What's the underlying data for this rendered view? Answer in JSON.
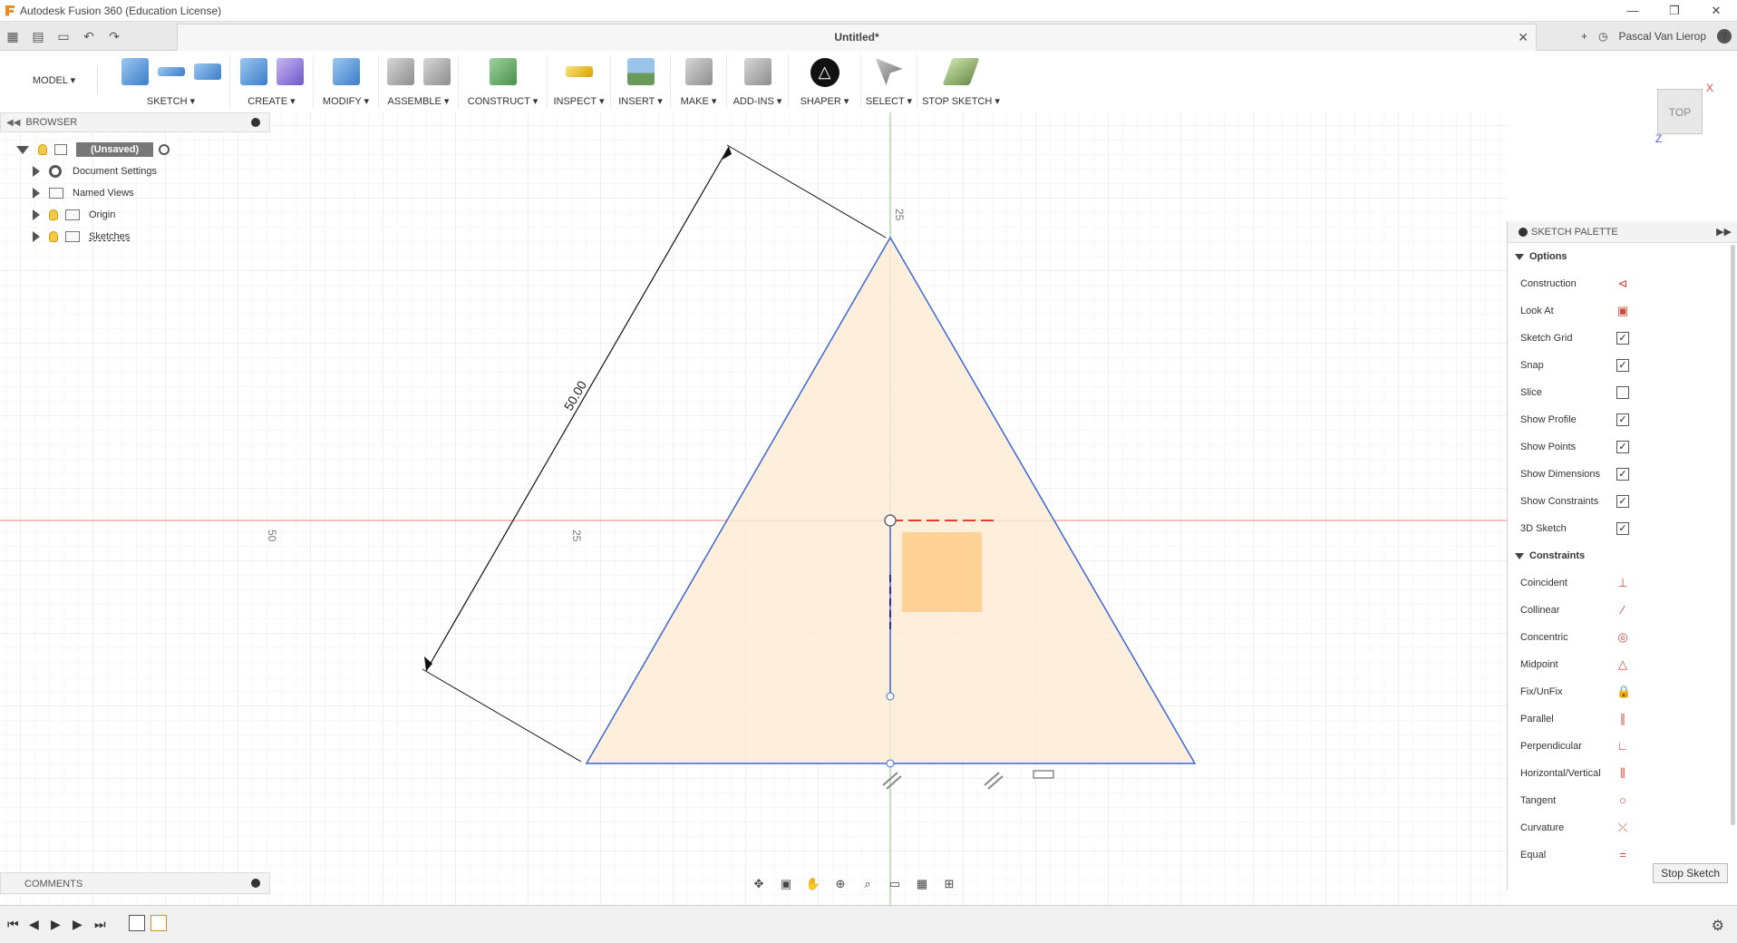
{
  "window": {
    "title": "Autodesk Fusion 360 (Education License)",
    "min": "—",
    "max": "❐",
    "close": "✕"
  },
  "tabbar": {
    "doc_title": "Untitled*",
    "user": "Pascal Van Lierop",
    "help": "?"
  },
  "toolbar": {
    "workspace": "MODEL ▾",
    "groups": [
      "SKETCH ▾",
      "CREATE ▾",
      "MODIFY ▾",
      "ASSEMBLE ▾",
      "CONSTRUCT ▾",
      "INSPECT ▾",
      "INSERT ▾",
      "MAKE ▾",
      "ADD-INS ▾",
      "SHAPER ▾",
      "SELECT ▾",
      "STOP SKETCH ▾"
    ]
  },
  "browser": {
    "header": "BROWSER",
    "root": "(Unsaved)",
    "items": [
      "Document Settings",
      "Named Views",
      "Origin",
      "Sketches"
    ]
  },
  "comments": {
    "label": "COMMENTS"
  },
  "viewcube": {
    "face": "TOP",
    "x_axis": "X",
    "z_axis": "Z"
  },
  "sketch": {
    "dim_main": "50.00",
    "grid_label_top": "25",
    "grid_label_left_outer": "50",
    "grid_label_left_inner": "25"
  },
  "palette": {
    "header": "SKETCH PALETTE",
    "options_title": "Options",
    "options": [
      {
        "label": "Construction",
        "type": "icon",
        "icon": "construction-icon",
        "glyph": "⊲"
      },
      {
        "label": "Look At",
        "type": "icon",
        "icon": "look-at-icon",
        "glyph": "▣"
      },
      {
        "label": "Sketch Grid",
        "type": "check",
        "checked": "✓"
      },
      {
        "label": "Snap",
        "type": "check",
        "checked": "✓"
      },
      {
        "label": "Slice",
        "type": "check",
        "checked": ""
      },
      {
        "label": "Show Profile",
        "type": "check",
        "checked": "✓"
      },
      {
        "label": "Show Points",
        "type": "check",
        "checked": "✓"
      },
      {
        "label": "Show Dimensions",
        "type": "check",
        "checked": "✓"
      },
      {
        "label": "Show Constraints",
        "type": "check",
        "checked": "✓"
      },
      {
        "label": "3D Sketch",
        "type": "check",
        "checked": "✓"
      }
    ],
    "constraints_title": "Constraints",
    "constraints": [
      {
        "label": "Coincident",
        "icon": "coincident-icon",
        "glyph": "⊥"
      },
      {
        "label": "Collinear",
        "icon": "collinear-icon",
        "glyph": "⁄"
      },
      {
        "label": "Concentric",
        "icon": "concentric-icon",
        "glyph": "◎"
      },
      {
        "label": "Midpoint",
        "icon": "midpoint-icon",
        "glyph": "△"
      },
      {
        "label": "Fix/UnFix",
        "icon": "lock-icon",
        "glyph": "🔒"
      },
      {
        "label": "Parallel",
        "icon": "parallel-icon",
        "glyph": "∥"
      },
      {
        "label": "Perpendicular",
        "icon": "perpendicular-icon",
        "glyph": "∟"
      },
      {
        "label": "Horizontal/Vertical",
        "icon": "horizontal-vertical-icon",
        "glyph": "⫼"
      },
      {
        "label": "Tangent",
        "icon": "tangent-icon",
        "glyph": "○"
      },
      {
        "label": "Curvature",
        "icon": "curvature-icon",
        "glyph": "⤫"
      },
      {
        "label": "Equal",
        "icon": "equal-icon",
        "glyph": "="
      }
    ],
    "stop_button": "Stop Sketch"
  },
  "colors": {
    "accent_red": "#e05050",
    "axis_green": "#5cc65c",
    "profile_fill": "#fdebd3",
    "line_blue": "#3a66d8"
  }
}
